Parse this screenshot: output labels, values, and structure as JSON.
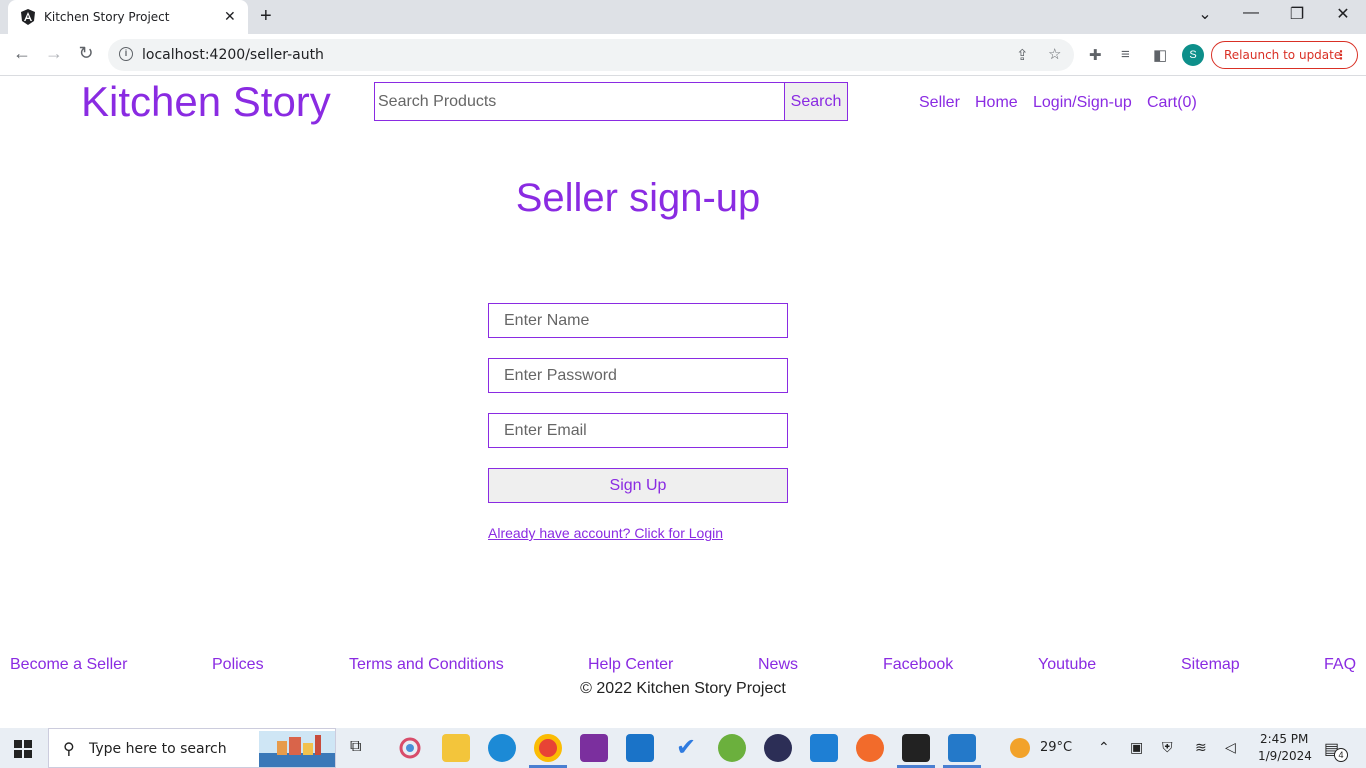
{
  "browser": {
    "tab_title": "Kitchen Story Project",
    "tab_close": "✕",
    "new_tab": "+",
    "url_host": "localhost:4200/seller-auth",
    "profile_initial": "S",
    "relaunch_label": "Relaunch to update",
    "window_controls": {
      "chevron": "⌄",
      "minimize": "—",
      "restore": "❐",
      "close": "✕"
    }
  },
  "header": {
    "brand": "Kitchen Story",
    "search_placeholder": "Search Products",
    "search_button": "Search",
    "nav": [
      "Seller",
      "Home",
      "Login/Sign-up",
      "Cart(0)"
    ]
  },
  "main": {
    "heading": "Seller sign-up",
    "fields": {
      "name_placeholder": "Enter Name",
      "password_placeholder": "Enter Password",
      "email_placeholder": "Enter Email"
    },
    "submit_label": "Sign Up",
    "login_link": "Already have account? Click for Login"
  },
  "footer": {
    "links": [
      "Become a Seller",
      "Polices",
      "Terms and Conditions",
      "Help Center",
      "News",
      "Facebook",
      "Youtube",
      "Sitemap",
      "FAQ"
    ],
    "copyright": "© 2022 Kitchen Story Project"
  },
  "taskbar": {
    "search_placeholder": "Type here to search",
    "weather_temp": "29°C",
    "time": "2:45 PM",
    "date": "1/9/2024",
    "notification_count": "4"
  },
  "colors": {
    "accent": "#8a2be2",
    "relaunch": "#d93025"
  }
}
